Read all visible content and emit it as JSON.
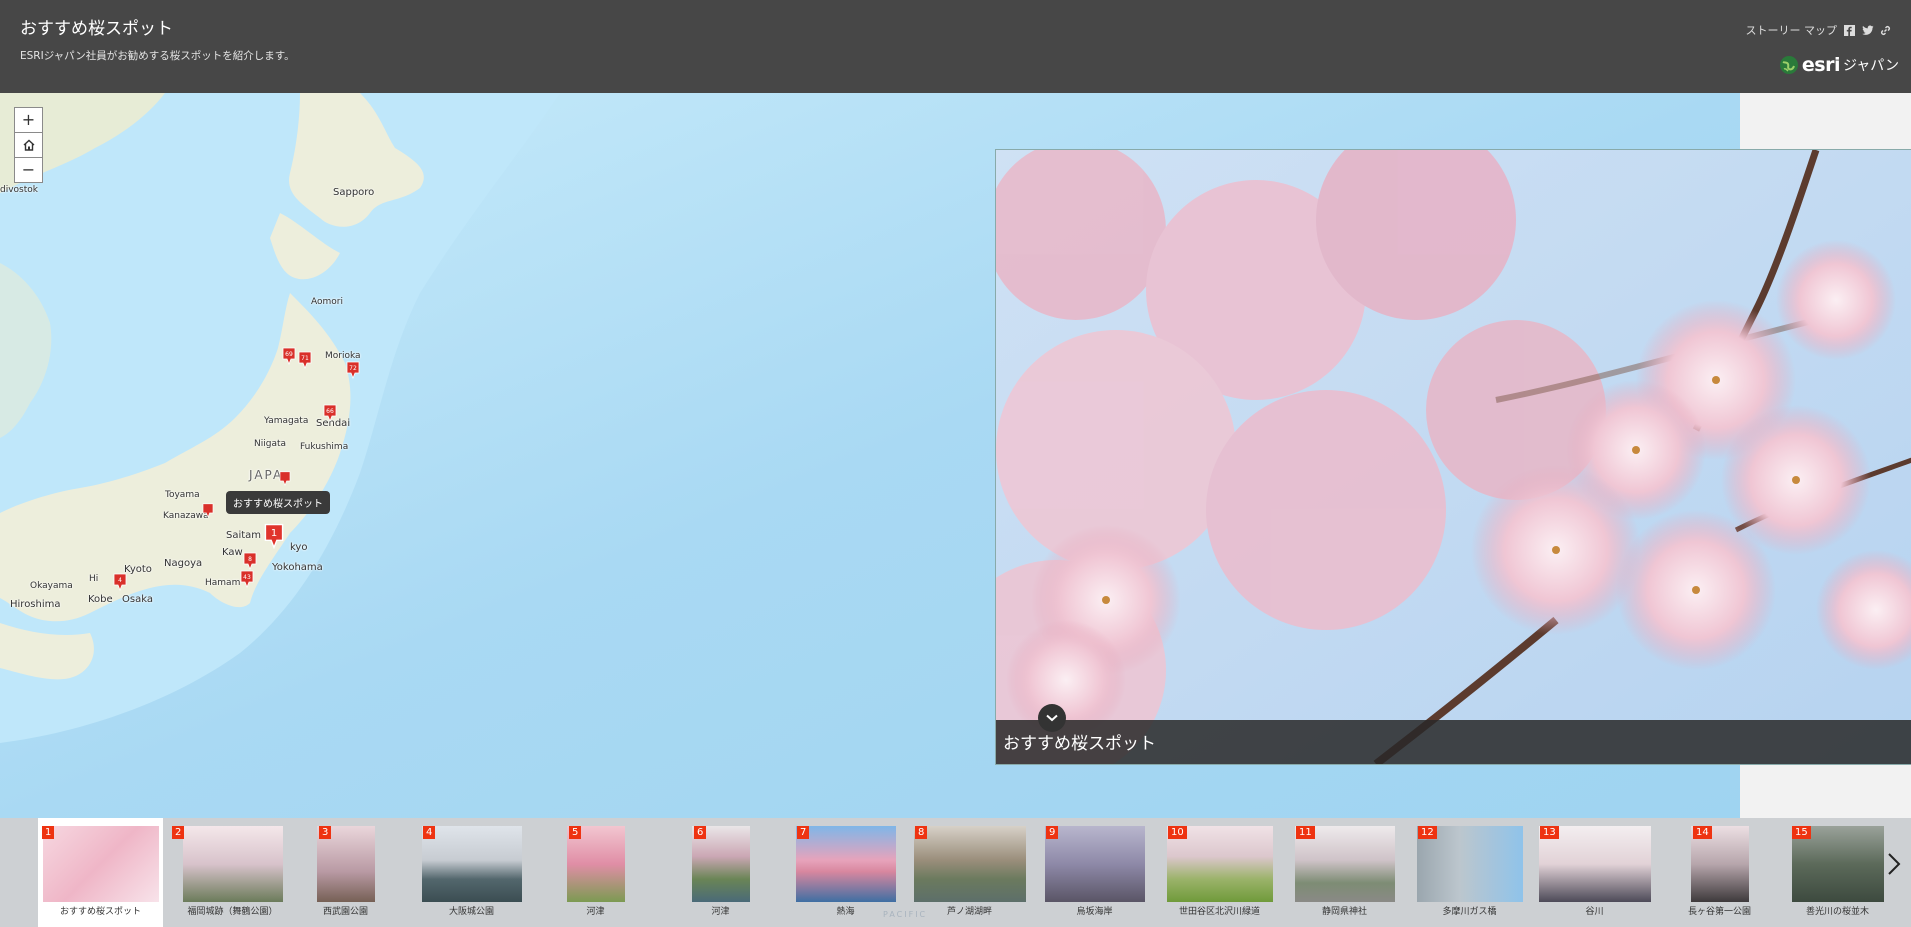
{
  "header": {
    "title": "おすすめ桜スポット",
    "subtitle": "ESRIジャパン社員がお勧めする桜スポットを紹介します。",
    "storymap_label": "ストーリー マップ",
    "share_icons": [
      "facebook-icon",
      "twitter-icon",
      "link-icon"
    ],
    "logo_text": "esri",
    "logo_sub": "ジャパン",
    "bg_color": "#474747"
  },
  "map": {
    "zoom_in": "+",
    "zoom_out": "−",
    "labels": {
      "vladivostok": "divostok",
      "sapporo": "Sapporo",
      "aomori": "Aomori",
      "morioka": "Morioka",
      "yamagata": "Yamagata",
      "sendai": "Sendai",
      "niigata": "Niigata",
      "fukushima": "Fukushima",
      "japan": "JAPA",
      "toyama": "Toyama",
      "kanazawa": "Kanazawa",
      "saitama": "Saitam",
      "tokyo": "kyo",
      "kawasaki": "Kaw",
      "yokohama": "Yokohama",
      "nagoya": "Nagoya",
      "kyoto": "Kyoto",
      "kobe": "Kobe",
      "osaka": "Osaka",
      "okayama": "Okayama",
      "hiroshima": "Hiroshima",
      "hamamatsu": "Hamam",
      "himeji": "Hi"
    },
    "tooltip": "おすすめ桜スポット",
    "pin_labels": [
      "69",
      "71",
      "72",
      "66",
      "1",
      "8",
      "4",
      "43"
    ]
  },
  "media": {
    "caption": "おすすめ桜スポット"
  },
  "carousel": {
    "watermark": "PACIFIC",
    "items": [
      {
        "num": "1",
        "label": "おすすめ桜スポット"
      },
      {
        "num": "2",
        "label": "福岡城跡（舞鶴公園）"
      },
      {
        "num": "3",
        "label": "西武園公園"
      },
      {
        "num": "4",
        "label": "大阪城公園"
      },
      {
        "num": "5",
        "label": "河津"
      },
      {
        "num": "6",
        "label": "河津"
      },
      {
        "num": "7",
        "label": "熱海"
      },
      {
        "num": "8",
        "label": "芦ノ湖湖畔"
      },
      {
        "num": "9",
        "label": "烏坂海岸"
      },
      {
        "num": "10",
        "label": "世田谷区北沢川緑道"
      },
      {
        "num": "11",
        "label": "静岡県神社"
      },
      {
        "num": "12",
        "label": "多摩川ガス橋"
      },
      {
        "num": "13",
        "label": "谷川"
      },
      {
        "num": "14",
        "label": "長ヶ谷第一公園"
      },
      {
        "num": "15",
        "label": "善光川の桜並木"
      }
    ]
  }
}
